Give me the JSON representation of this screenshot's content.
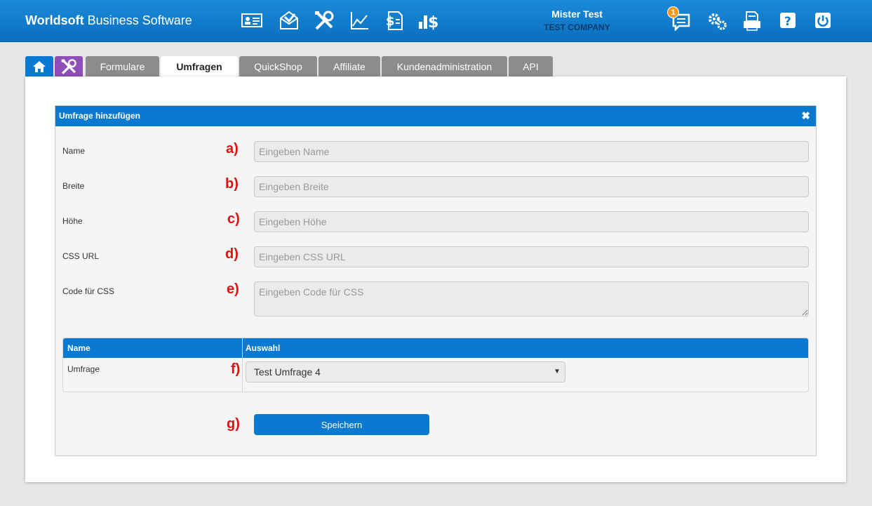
{
  "app": {
    "brand_bold": "Worldsoft",
    "brand_rest": " Business Software",
    "user_name": "Mister Test",
    "company": "TEST COMPANY",
    "notification_count": "1",
    "accent_color": "#0a7ad0",
    "nav_icons": [
      "contact-card-icon",
      "mail-icon",
      "tools-icon",
      "chart-icon",
      "invoice-icon",
      "revenue-icon"
    ],
    "right_icons": [
      "messages-icon",
      "settings-icon",
      "print-icon",
      "help-icon",
      "power-icon"
    ]
  },
  "tabs": [
    {
      "label": "",
      "icon": "home-icon"
    },
    {
      "label": "",
      "icon": "tools-icon"
    },
    {
      "label": "Formulare"
    },
    {
      "label": "Umfragen",
      "active": true
    },
    {
      "label": "QuickShop"
    },
    {
      "label": "Affiliate"
    },
    {
      "label": "Kundenadministration"
    },
    {
      "label": "API"
    }
  ],
  "dialog": {
    "title": "Umfrage hinzufügen",
    "close_glyph": "✖",
    "fields": [
      {
        "label": "Name",
        "marker": "a)",
        "placeholder": "Eingeben Name"
      },
      {
        "label": "Breite",
        "marker": "b)",
        "placeholder": "Eingeben Breite"
      },
      {
        "label": "Höhe",
        "marker": "c)",
        "placeholder": "Eingeben Höhe"
      },
      {
        "label": "CSS URL",
        "marker": "d)",
        "placeholder": "Eingeben CSS URL"
      },
      {
        "label": "Code für CSS",
        "marker": "e)",
        "placeholder": "Eingeben Code für CSS"
      }
    ],
    "table": {
      "headers": [
        "Name",
        "Auswahl"
      ],
      "row_label": "Umfrage",
      "marker": "f)",
      "selected": "Test Umfrage 4"
    },
    "save_marker": "g)",
    "save_label": "Speichern"
  }
}
